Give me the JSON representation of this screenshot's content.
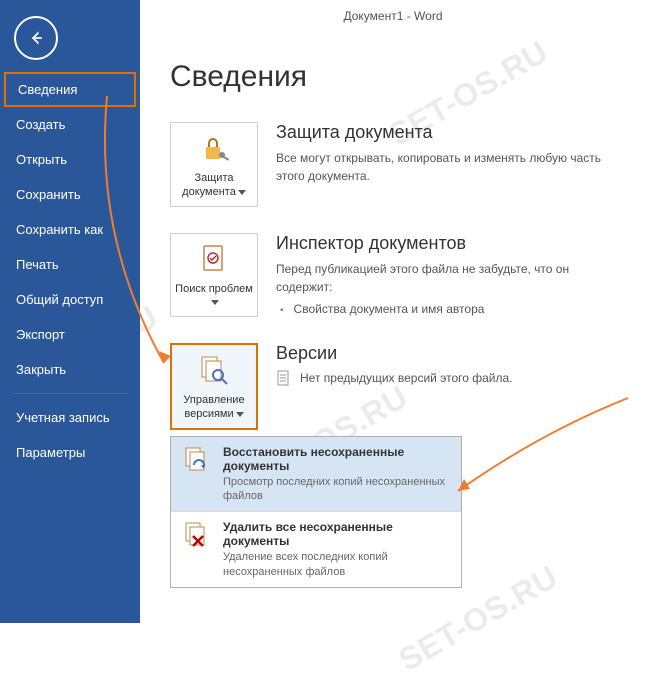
{
  "header": {
    "title": "Документ1 - Word"
  },
  "sidebar": {
    "items": [
      {
        "label": "Сведения",
        "active": true
      },
      {
        "label": "Создать"
      },
      {
        "label": "Открыть"
      },
      {
        "label": "Сохранить"
      },
      {
        "label": "Сохранить как"
      },
      {
        "label": "Печать"
      },
      {
        "label": "Общий доступ"
      },
      {
        "label": "Экспорт"
      },
      {
        "label": "Закрыть"
      },
      {
        "label": "Учетная запись"
      },
      {
        "label": "Параметры"
      }
    ]
  },
  "page": {
    "title": "Сведения"
  },
  "protect": {
    "button_label": "Защита документа",
    "title": "Защита документа",
    "desc": "Все могут открывать, копировать и изменять любую часть этого документа."
  },
  "inspect": {
    "button_label": "Поиск проблем",
    "title": "Инспектор документов",
    "desc": "Перед публикацией этого файла не забудьте, что он содержит:",
    "bullet1": "Свойства документа и имя автора"
  },
  "versions": {
    "button_label": "Управление версиями",
    "title": "Версии",
    "none_text": "Нет предыдущих версий этого файла.",
    "dropdown": [
      {
        "title": "Восстановить несохраненные документы",
        "desc": "Просмотр последних копий несохраненных файлов"
      },
      {
        "title": "Удалить все несохраненные документы",
        "desc": "Удаление всех последних копий несохраненных файлов"
      }
    ]
  },
  "watermark_text": "SET-OS.RU",
  "colors": {
    "sidebar_bg": "#2a579a",
    "highlight_border": "#e17000",
    "arrow": "#ed7d31"
  }
}
